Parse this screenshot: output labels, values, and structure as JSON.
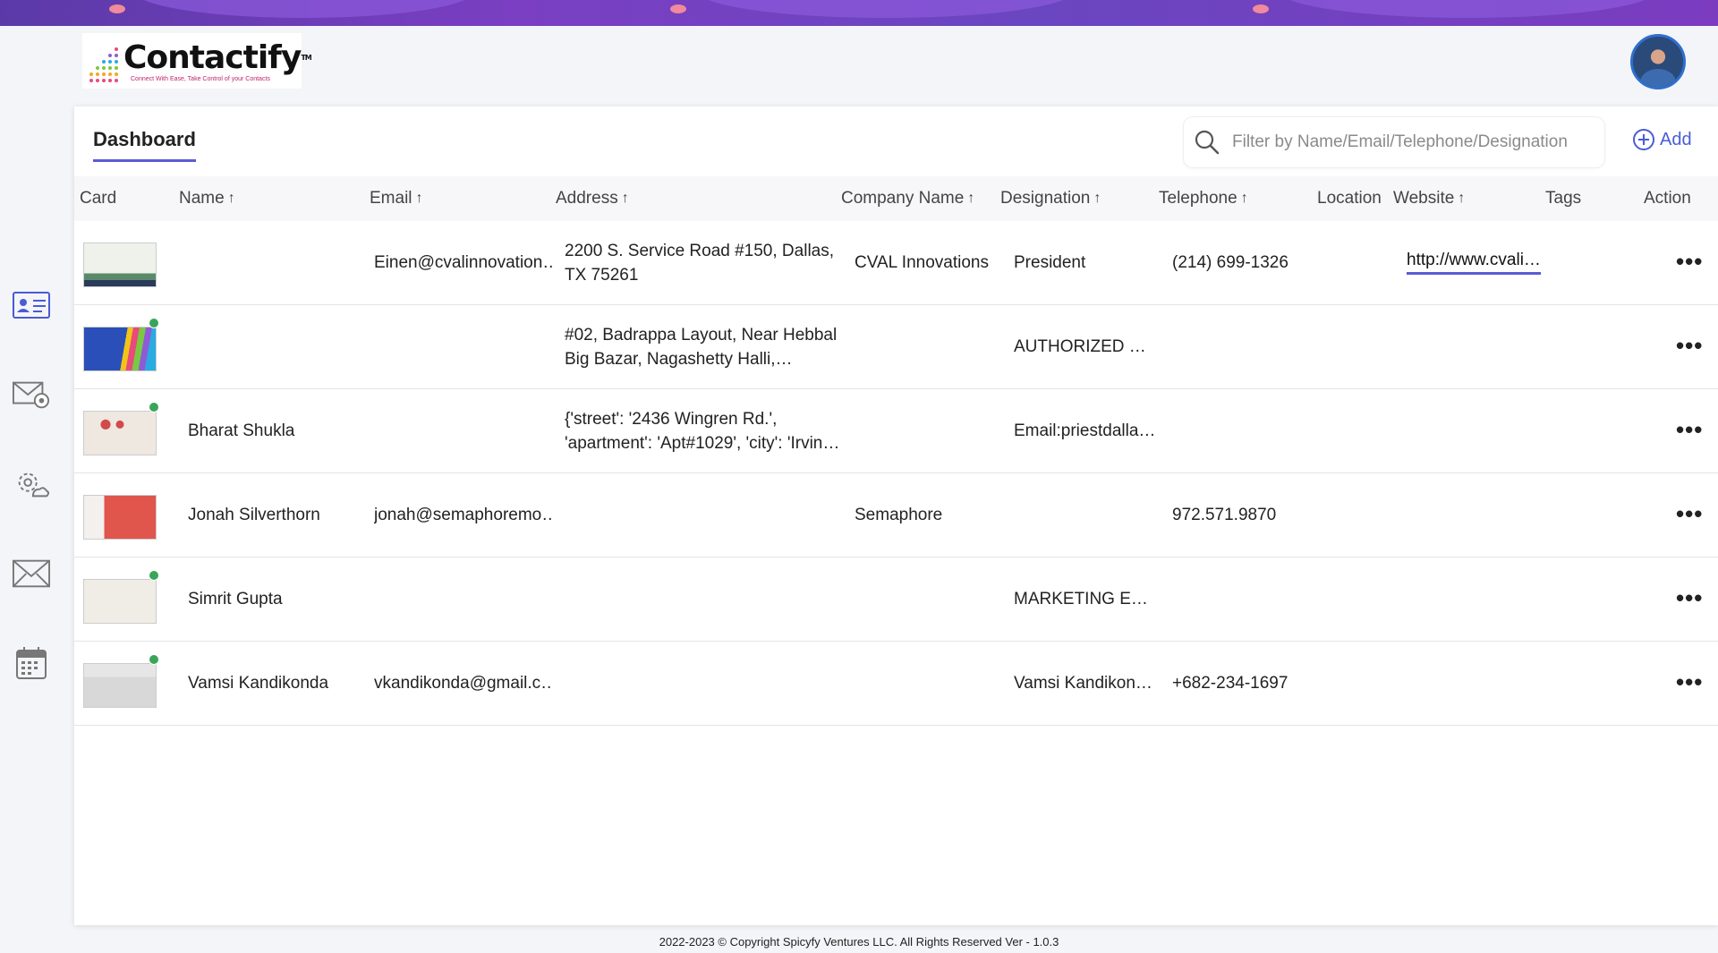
{
  "app": {
    "name": "Contactify",
    "tm": "TM",
    "tagline": "Connect With Ease, Take Control of your Contacts"
  },
  "colors": {
    "accent": "#5b5bd6",
    "banner": "#6a46c0",
    "status_green": "#3aa55a"
  },
  "sidebar": {
    "items": [
      {
        "icon": "contact-card-icon"
      },
      {
        "icon": "mail-settings-icon"
      },
      {
        "icon": "gear-cloud-icon"
      },
      {
        "icon": "envelope-icon"
      },
      {
        "icon": "calendar-icon"
      }
    ]
  },
  "main": {
    "tab": "Dashboard",
    "search_placeholder": "Filter by Name/Email/Telephone/Designation",
    "add_label": "Add",
    "columns": {
      "card": "Card",
      "name": "Name",
      "email": "Email",
      "address": "Address",
      "company": "Company Name",
      "designation": "Designation",
      "telephone": "Telephone",
      "location": "Location",
      "website": "Website",
      "tags": "Tags",
      "action": "Action"
    },
    "sort_arrow": "↑",
    "more_icon": "•••",
    "rows": [
      {
        "name": "",
        "email": "Einen@cvalinnovation…",
        "address": "2200 S. Service Road #150, Dallas, TX 75261",
        "company": "CVAL Innovations",
        "designation": "President",
        "telephone": "(214) 699-1326",
        "location": "",
        "website": "http://www.cvali…",
        "tags": "",
        "status_dot": false,
        "card_color": "#e9efe6"
      },
      {
        "name": "",
        "email": "",
        "address": "#02, Badrappa Layout, Near Hebbal Big Bazar, Nagashetty Halli,…",
        "company": "",
        "designation": "AUTHORIZED …",
        "telephone": "",
        "location": "",
        "website": "",
        "tags": "",
        "status_dot": true,
        "card_color": "#2a4fb8"
      },
      {
        "name": "Bharat Shukla",
        "email": "",
        "address": "{'street': '2436 Wingren Rd.', 'apartment': 'Apt#1029', 'city': 'Irvin…",
        "company": "",
        "designation": "Email:priestdalla…",
        "telephone": "",
        "location": "",
        "website": "",
        "tags": "",
        "status_dot": true,
        "card_color": "#efe8e0"
      },
      {
        "name": "Jonah Silverthorn",
        "email": "jonah@semaphoremo…",
        "address": "",
        "company": "Semaphore",
        "designation": "",
        "telephone": "972.571.9870",
        "location": "",
        "website": "",
        "tags": "",
        "status_dot": false,
        "card_color": "#e0554c"
      },
      {
        "name": "Simrit Gupta",
        "email": "",
        "address": "",
        "company": "",
        "designation": "MARKETING E…",
        "telephone": "",
        "location": "",
        "website": "",
        "tags": "",
        "status_dot": true,
        "card_color": "#f0ece6"
      },
      {
        "name": "Vamsi Kandikonda",
        "email": "vkandikonda@gmail.c…",
        "address": "",
        "company": "",
        "designation": "Vamsi Kandikon…",
        "telephone": "+682-234-1697",
        "location": "",
        "website": "",
        "tags": "",
        "status_dot": true,
        "card_color": "#e6e6e6"
      }
    ]
  },
  "footer": "2022-2023 © Copyright Spicyfy Ventures LLC. All Rights Reserved  Ver - 1.0.3"
}
